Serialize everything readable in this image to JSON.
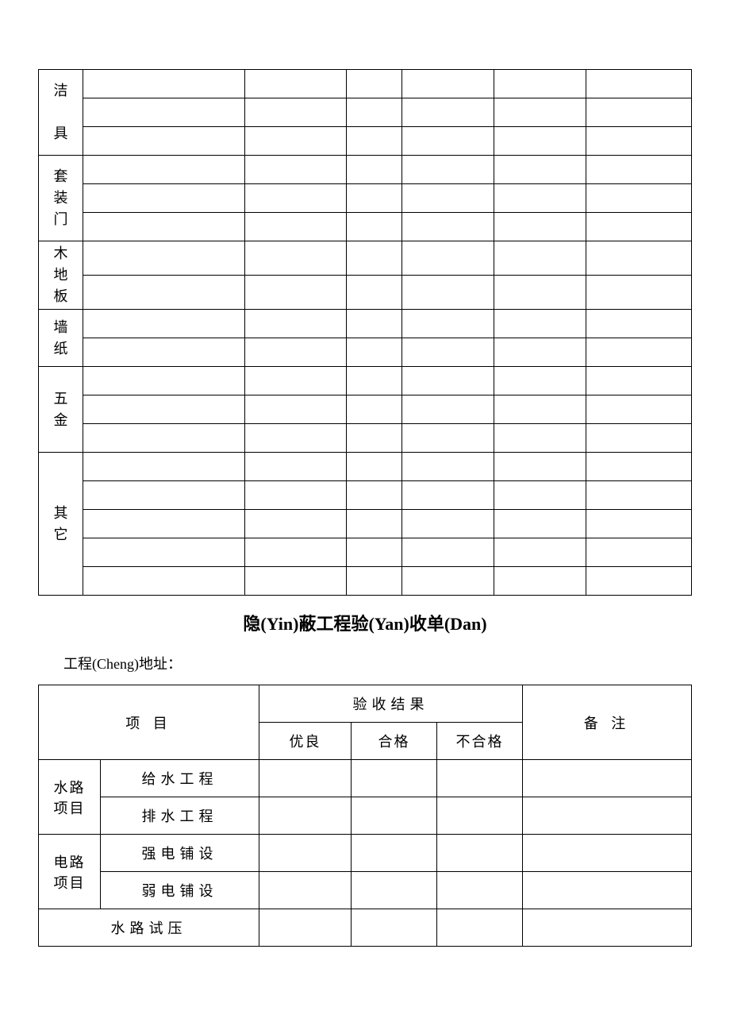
{
  "table1": {
    "rows": [
      {
        "label": "洁\n\n具"
      },
      {
        "label": "套\n装\n门"
      },
      {
        "label": "木\n地\n板"
      },
      {
        "label": "墙\n纸"
      },
      {
        "label": "五\n金"
      },
      {
        "label": "其\n它"
      }
    ]
  },
  "section_title": "隐(Yin)蔽工程验(Yan)收单(Dan)",
  "address_label": "工程(Cheng)地址：",
  "table2": {
    "header": {
      "col_project": "项  目",
      "col_result": "验收结果",
      "col_note": "备  注",
      "col_excellent": "优良",
      "col_qualified": "合格",
      "col_unqualified": "不合格"
    },
    "body": [
      {
        "group": "水路\n项目",
        "items": [
          "给水工程",
          "排水工程"
        ]
      },
      {
        "group": "电路\n项目",
        "items": [
          "强电铺设",
          "弱电铺设"
        ]
      }
    ],
    "last_row": "水路试压"
  }
}
